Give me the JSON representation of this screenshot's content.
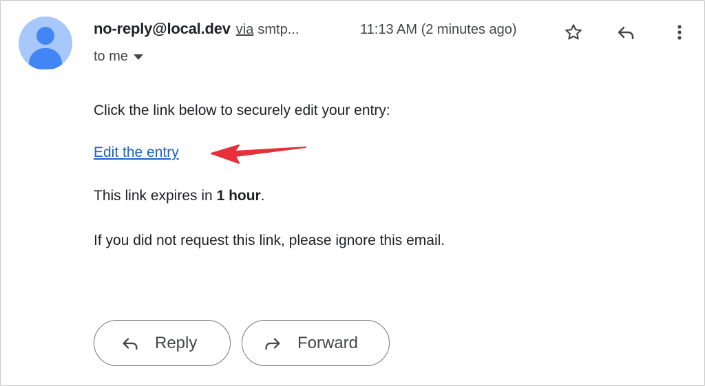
{
  "header": {
    "sender_email": "no-reply@local.dev",
    "via_label": "via",
    "via_rest": "smtp...",
    "time": "11:13 AM (2 minutes ago)",
    "recipient": "to me"
  },
  "body": {
    "intro": "Click the link below to securely edit your entry:",
    "link_text": "Edit the entry",
    "expiry_prefix": "This link expires in ",
    "expiry_bold": "1 hour",
    "expiry_suffix": ".",
    "ignore_note": "If you did not request this link, please ignore this email."
  },
  "actions": {
    "reply_label": "Reply",
    "forward_label": "Forward"
  },
  "icons": {
    "avatar": "person-avatar-icon",
    "star": "star-icon",
    "reply": "reply-icon",
    "more": "more-vert-icon",
    "dropdown": "caret-down-icon",
    "forward": "forward-icon",
    "annotation": "red-arrow-annotation"
  },
  "colors": {
    "link": "#1a5fd0",
    "annotation_arrow": "#e8303a",
    "avatar_bg": "#a8c7fa",
    "avatar_fg": "#4285f4"
  }
}
